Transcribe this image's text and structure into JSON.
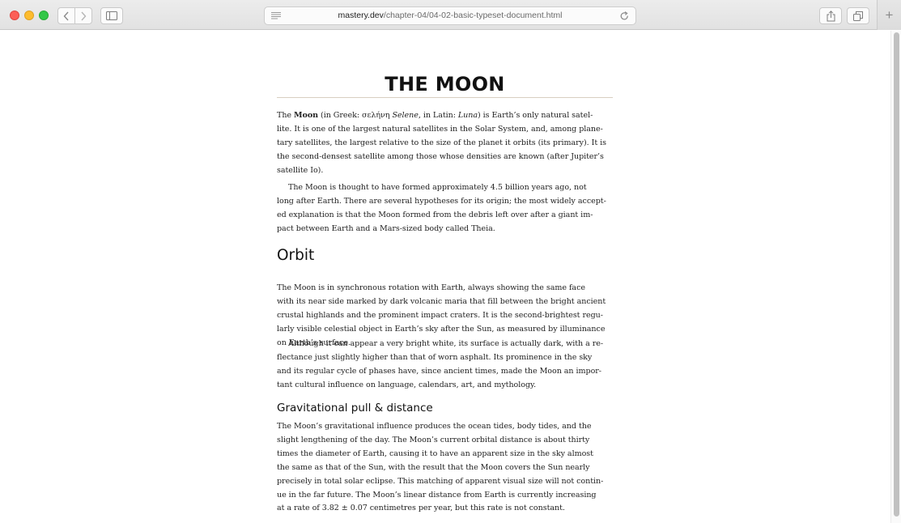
{
  "browser": {
    "url_host": "mastery.dev",
    "url_path": "/chapter-04/04-02-basic-typeset-document.html",
    "new_tab_label": "+",
    "icons": {
      "back": "chevron-left-icon",
      "forward": "chevron-right-icon",
      "sidebar": "sidebar-icon",
      "reader": "reader-icon",
      "reload": "reload-icon",
      "share": "share-icon",
      "tabs": "tabs-overview-icon"
    }
  },
  "article": {
    "title": "THE MOON",
    "intro": {
      "p1": {
        "l1_a": "The ",
        "l1_bold": "Moon",
        "l1_b": " (in Greek: σελήνη ",
        "l1_italic1": "Selene",
        "l1_c": ", in Latin: ",
        "l1_italic2": "Luna",
        "l1_d": ") is Earth’s only natural satel-",
        "l2": "lite. It is one of the largest natural satellites in the Solar System, and, among plane-",
        "l3": "tary satellites, the largest relative to the size of the planet it orbits (its primary). It is",
        "l4": "the second-densest satellite among those whose densities are known (after Jupiter’s",
        "l5": "satellite Io)."
      },
      "p2": {
        "l1": "The Moon is thought to have formed approximately 4.5 billion years ago, not",
        "l2": "long after Earth. There are several hypotheses for its origin; the most widely accept-",
        "l3": "ed explanation is that the Moon formed from the debris left over after a giant im-",
        "l4": "pact between Earth and a Mars-sized body called Theia."
      }
    },
    "orbit": {
      "heading": "Orbit",
      "p1": {
        "l1": "The Moon is in synchronous rotation with Earth, always showing the same face",
        "l2": "with its near side marked by dark volcanic maria that fill between the bright ancient",
        "l3": "crustal highlands and the prominent impact craters. It is the second-brightest regu-",
        "l4": "larly visible celestial object in Earth’s sky after the Sun, as measured by illuminance",
        "l5": "on Earth’s surface."
      },
      "p2": {
        "l1": "Although it can appear a very bright white, its surface is actually dark, with a re-",
        "l2": "flectance just slightly higher than that of worn asphalt. Its prominence in the sky",
        "l3": "and its regular cycle of phases have, since ancient times, made the Moon an impor-",
        "l4": "tant cultural influence on language, calendars, art, and mythology."
      }
    },
    "gravity": {
      "heading": "Gravitational pull & distance",
      "p1": {
        "l1": "The Moon’s gravitational influence produces the ocean tides, body tides, and the",
        "l2": "slight lengthening of the day. The Moon’s current orbital distance is about thirty",
        "l3": "times the diameter of Earth, causing it to have an apparent size in the sky almost",
        "l4": "the same as that of the Sun, with the result that the Moon covers the Sun nearly",
        "l5": "precisely in total solar eclipse. This matching of apparent visual size will not contin-",
        "l6": "ue in the far future. The Moon’s linear distance from Earth is currently increasing",
        "l7": "at a rate of 3.82 ± 0.07 centimetres per year, but this rate is not constant."
      }
    }
  }
}
